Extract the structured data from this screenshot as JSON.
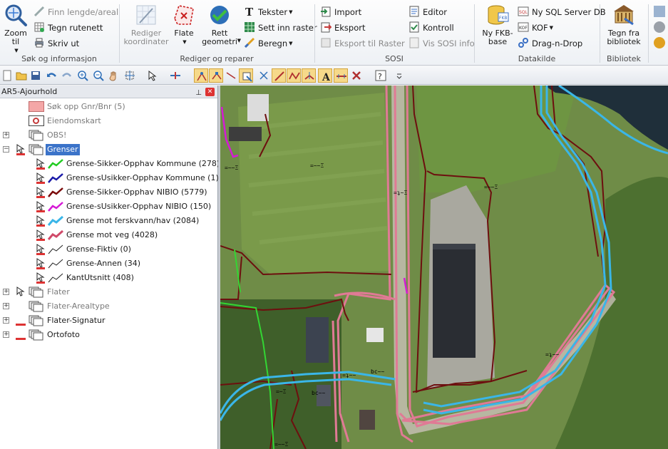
{
  "ribbon": {
    "groups": {
      "search": "Søk og informasjon",
      "edit": "Rediger og reparer",
      "sosi": "SOSI",
      "datakilde": "Datakilde",
      "bibliotek": "Bibliotek"
    },
    "zoom_label": "Zoom til",
    "measure_label": "Finn lengde/areal",
    "grid_label": "Tegn rutenett",
    "print_label": "Skriv ut",
    "edit_coords_label": "Rediger koordinater",
    "area_label": "Flate",
    "fix_geometry_label": "Rett geometri",
    "texts_label": "Tekster",
    "insert_raster_label": "Sett inn raster",
    "compute_label": "Beregn",
    "import_label": "Import",
    "export_label": "Eksport",
    "export_raster_label": "Eksport til Raster",
    "editor_label": "Editor",
    "control_label": "Kontroll",
    "sosi_info_label": "Vis SOSI info",
    "new_fkb_label": "Ny FKB-base",
    "new_sql_label": "Ny SQL Server DB",
    "kof_label": "KOF",
    "drag_drop_label": "Drag-n-Drop",
    "draw_lib_label": "Tegn fra bibliotek"
  },
  "panel": {
    "title": "AR5-Ajourhold",
    "pin": "⊥",
    "close": "✕"
  },
  "tree": [
    {
      "id": "sok",
      "label": "Søk opp Gnr/Bnr (5)",
      "grey": true
    },
    {
      "id": "eiendom",
      "label": "Eiendomskart",
      "grey": true
    },
    {
      "id": "obs",
      "label": "OBS!",
      "grey": true
    },
    {
      "id": "grenser",
      "label": "Grenser",
      "selected": true
    },
    {
      "id": "g1",
      "label": "Grense-Sikker-Opphav Kommune (278)",
      "color": "#22cc22"
    },
    {
      "id": "g2",
      "label": "Grense-sUsikker-Opphav Kommune (1)",
      "color": "#1a1aa8"
    },
    {
      "id": "g3",
      "label": "Grense-Sikker-Opphav NIBIO (5779)",
      "color": "#7a0a0a"
    },
    {
      "id": "g4",
      "label": "Grense-sUsikker-Opphav NIBIO (150)",
      "color": "#d51ad5"
    },
    {
      "id": "g5",
      "label": "Grense mot ferskvann/hav (2084)",
      "color": "#3ab6e8"
    },
    {
      "id": "g6",
      "label": "Grense  mot veg (4028)",
      "color": "#d04a6a"
    },
    {
      "id": "g7",
      "label": "Grense-Fiktiv (0)",
      "color": "#222222"
    },
    {
      "id": "g8",
      "label": "Grense-Annen (34)",
      "color": "#222222"
    },
    {
      "id": "g9",
      "label": "KantUtsnitt (408)",
      "color": "#222222"
    },
    {
      "id": "flater",
      "label": "Flater",
      "grey": true
    },
    {
      "id": "arealtype",
      "label": "Flater-Arealtype",
      "grey": true
    },
    {
      "id": "signatur",
      "label": "Flater-Signatur"
    },
    {
      "id": "ortofoto",
      "label": "Ortofoto"
    }
  ],
  "map": {
    "labels": {
      "l1": "=~~Ξ",
      "l2": "=~~Ξ",
      "l3": "=~~Ξ",
      "l4": "=ʇ~Ξ",
      "l5": "bc~~",
      "l6": "bc~~",
      "l7": "=ʇ~~",
      "l8": "=ʇ~~",
      "l9": "=~Ξ",
      "l10": "=~~Ξ"
    }
  }
}
